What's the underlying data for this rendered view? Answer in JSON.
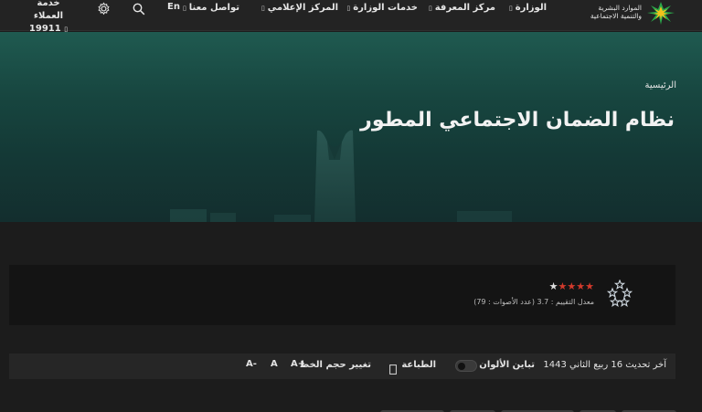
{
  "logo": {
    "line1": "الموارد البشرية",
    "line2": "والتنمية الاجتماعية"
  },
  "nav": {
    "items": [
      {
        "label": "الوزارة"
      },
      {
        "label": "مركز المعرفة"
      },
      {
        "label": "خدمات الوزارة"
      },
      {
        "label": "المركز الإعلامي"
      },
      {
        "label": "تواصل معنا"
      }
    ],
    "chevron": "▯",
    "lang": "En",
    "hotline_label": "خدمة العملاء",
    "hotline_number": "19911"
  },
  "hero": {
    "breadcrumb": "الرئيسية",
    "title": "نظام الضمان الاجتماعي المطور"
  },
  "rating": {
    "stars_full": 4,
    "stars_total": 5,
    "average_label": "معدل التقييم : 3.7 (عدد الأصوات : 79)",
    "average": 3.7,
    "votes": 79
  },
  "tools": {
    "last_update": "آخر تحديث 16 ربيع الثاني 1443",
    "contrast_label": "تباين الألوان",
    "print_label": "الطباعة",
    "font_size_label": "تغيير حجم الخط",
    "font_increase": "A+",
    "font_normal": "A",
    "font_decrease": "A-"
  },
  "colors": {
    "accent_green": "#1f5a50",
    "star_red": "#d33a2c",
    "logo_green": "#2aa84a",
    "logo_yellow": "#f2c21b"
  }
}
